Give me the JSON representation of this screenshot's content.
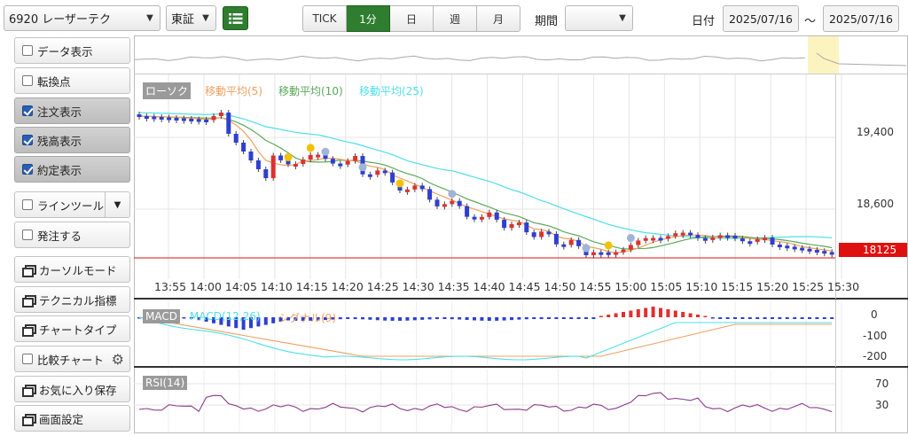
{
  "toolbar": {
    "stock_select": "6920 レーザーテク",
    "market_select": "東証",
    "list_icon": "list-icon",
    "intervals": [
      "TICK",
      "1分",
      "日",
      "週",
      "月"
    ],
    "active_interval": "1分",
    "period_label": "期間",
    "period_value": "",
    "date_label": "日付",
    "date_from": "2025/07/16",
    "date_sep": "～",
    "date_to": "2025/07/16"
  },
  "sidebar": {
    "data_display": "データ表示",
    "turning_point": "転換点",
    "order_display": "注文表示",
    "position_display": "残高表示",
    "execution_display": "約定表示",
    "line_tool": "ラインツール",
    "place_order": "発注する",
    "cursor_mode": "カーソルモード",
    "technical": "テクニカル指標",
    "chart_type": "チャートタイプ",
    "compare_chart": "比較チャート",
    "save_favorite": "お気に入り保存",
    "screen_settings": "画面設定"
  },
  "chart": {
    "legend": {
      "candle": "ローソク",
      "ma5": "移動平均(5)",
      "ma10": "移動平均(10)",
      "ma25": "移動平均(25)"
    },
    "price_labels": [
      "19,400",
      "18,600"
    ],
    "current_price": "18125",
    "time_labels": [
      "13:55",
      "14:00",
      "14:05",
      "14:10",
      "14:15",
      "14:20",
      "14:25",
      "14:30",
      "14:35",
      "14:40",
      "14:45",
      "14:50",
      "14:55",
      "15:00",
      "15:05",
      "15:10",
      "15:15",
      "15:20",
      "15:25",
      "15:30"
    ],
    "macd": {
      "label": "MACD",
      "macd_legend": "MACD(12,26)",
      "signal_legend": "シグナル(9)",
      "scale": [
        "0",
        "-100",
        "-200"
      ]
    },
    "rsi": {
      "label": "RSI(14)",
      "scale": [
        "70",
        "30"
      ]
    },
    "colors": {
      "up": "#e03030",
      "down": "#2f3fd0",
      "ma5": "#f0a060",
      "ma10": "#5aa85a",
      "ma25": "#4ee0e8",
      "rsi": "#8b3b8b",
      "current": "#e01010"
    }
  }
}
